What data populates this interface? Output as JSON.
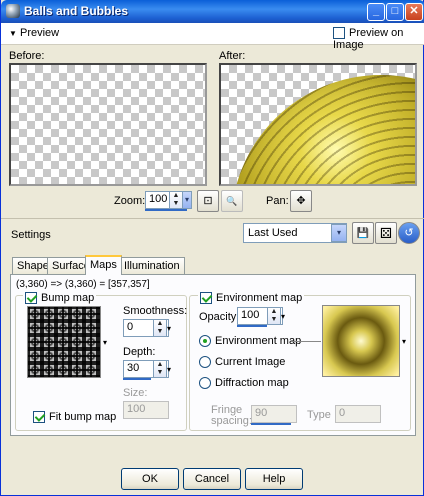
{
  "window": {
    "title": "Balls and Bubbles",
    "controls": {
      "minimize": "_",
      "maximize": "□",
      "close": "✕"
    }
  },
  "preview": {
    "toggle_label": "Preview",
    "toggle_arrow": "▼",
    "preview_on_image_label": "Preview on Image",
    "preview_on_image_checked": false,
    "before_label": "Before:",
    "after_label": "After:",
    "zoom_label": "Zoom:",
    "zoom_value": "100",
    "pan_label": "Pan:"
  },
  "settings": {
    "label": "Settings",
    "preset_value": "Last Used"
  },
  "tabs": [
    {
      "label": "Shape",
      "active": false
    },
    {
      "label": "Surface",
      "active": false
    },
    {
      "label": "Maps",
      "active": true
    },
    {
      "label": "Illumination",
      "active": false
    }
  ],
  "maps": {
    "coords_text": "(3,360) => (3,360) = [357,357]",
    "bump_map": {
      "label": "Bump map",
      "checked": true,
      "smoothness_label": "Smoothness:",
      "smoothness_value": "0",
      "depth_label": "Depth:",
      "depth_value": "30",
      "size_label": "Size:",
      "size_value": "100",
      "fit_label": "Fit bump map",
      "fit_checked": true
    },
    "environment_map": {
      "label": "Environment map",
      "checked": true,
      "opacity_label": "Opacity:",
      "opacity_value": "100",
      "options": [
        {
          "label": "Environment map",
          "selected": true
        },
        {
          "label": "Current Image",
          "selected": false
        },
        {
          "label": "Diffraction map",
          "selected": false
        }
      ],
      "fringe_label_1": "Fringe",
      "fringe_label_2": "spacing:",
      "fringe_value": "90",
      "type_label": "Type",
      "type_value": "0"
    }
  },
  "buttons": {
    "ok": "OK",
    "cancel": "Cancel",
    "help": "Help"
  },
  "icons": {
    "save": "💾",
    "dice": "⚄",
    "reset": "↺",
    "fit": "⊡",
    "zoom": "🔍",
    "pan": "✥"
  }
}
